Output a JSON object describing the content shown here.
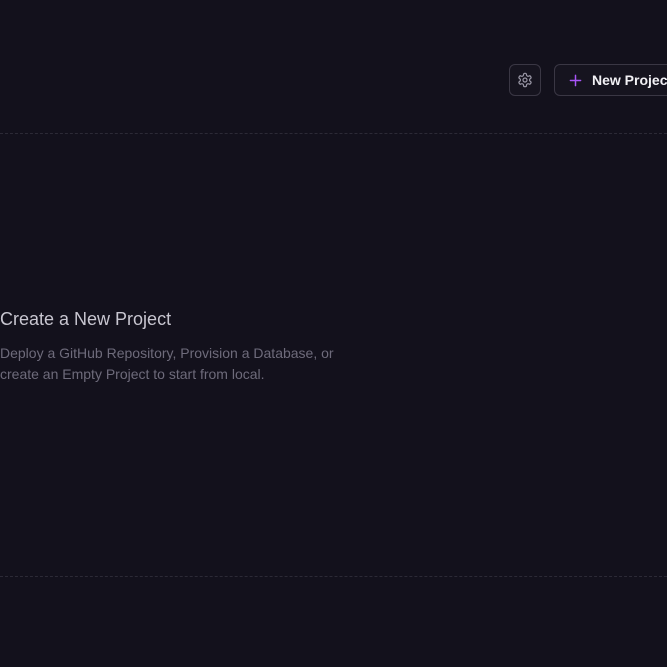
{
  "header": {
    "settings_icon": "gear-icon",
    "new_project_label": "New Project",
    "new_project_icon": "plus-icon"
  },
  "empty_state": {
    "title": "Create a New Project",
    "description": "Deploy a GitHub Repository, Provision a Database, or create an Empty Project to start from local."
  },
  "colors": {
    "background": "#13111c",
    "accent": "#a855f7",
    "border": "#3a3744",
    "title": "#c8c6d0",
    "muted": "#6e6b7b"
  }
}
